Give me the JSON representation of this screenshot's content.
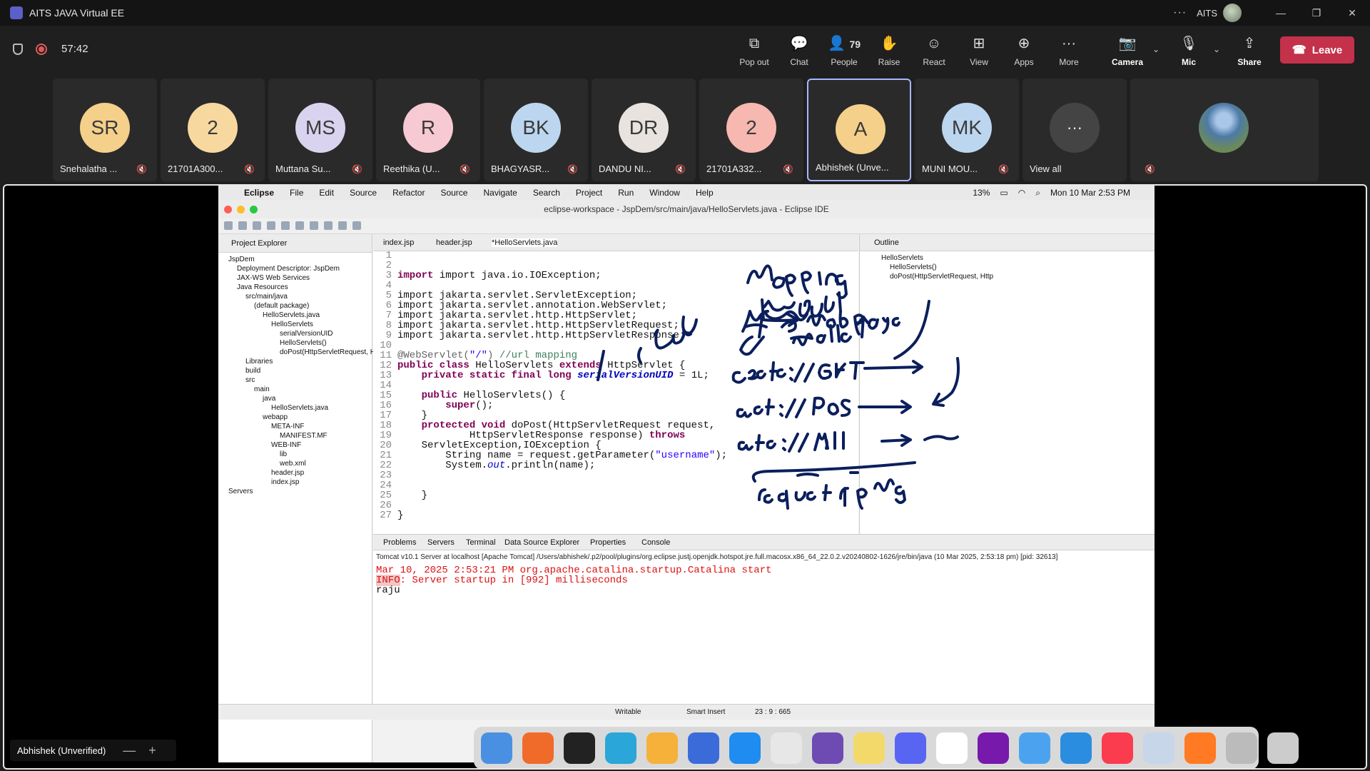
{
  "window": {
    "title": "AITS JAVA Virtual EE",
    "org": "AITS"
  },
  "meeting": {
    "timer": "57:42",
    "controls": {
      "popout": "Pop out",
      "chat": "Chat",
      "people": "People",
      "people_count": "79",
      "raise": "Raise",
      "react": "React",
      "view": "View",
      "apps": "Apps",
      "more": "More",
      "camera": "Camera",
      "mic": "Mic",
      "share": "Share",
      "leave": "Leave"
    },
    "participants": [
      {
        "initials": "SR",
        "name": "Snehalatha ...",
        "color": "#f5d08a"
      },
      {
        "initials": "2",
        "name": "21701A300...",
        "color": "#f7d9a0"
      },
      {
        "initials": "MS",
        "name": "Muttana Su...",
        "color": "#d9d3ef"
      },
      {
        "initials": "R",
        "name": "Reethika (U...",
        "color": "#f7c9d2"
      },
      {
        "initials": "BK",
        "name": "BHAGYASR...",
        "color": "#bcd6f0"
      },
      {
        "initials": "DR",
        "name": "DANDU NI...",
        "color": "#e8e3df"
      },
      {
        "initials": "2",
        "name": "21701A332...",
        "color": "#f6b8b0"
      },
      {
        "initials": "A",
        "name": "Abhishek (Unve...",
        "color": "#f5d08a"
      },
      {
        "initials": "MK",
        "name": "MUNI MOU...",
        "color": "#bcd6f0"
      }
    ],
    "view_all": "View all",
    "presenter_name": "Abhishek (Unverified)"
  },
  "mac_menu": {
    "app": "Eclipse",
    "items": [
      "File",
      "Edit",
      "Source",
      "Refactor",
      "Source",
      "Navigate",
      "Search",
      "Project",
      "Run",
      "Window",
      "Help"
    ],
    "battery": "13%",
    "clock": "Mon 10 Mar  2:53 PM"
  },
  "eclipse": {
    "title": "eclipse-workspace - JspDem/src/main/java/HelloServlets.java - Eclipse IDE",
    "project_explorer": {
      "title": "Project Explorer",
      "tree": [
        "JspDem",
        "Deployment Descriptor: JspDem",
        "JAX-WS Web Services",
        "Java Resources",
        "src/main/java",
        "(default package)",
        "HelloServlets.java",
        "HelloServlets",
        "serialVersionUID",
        "HelloServlets()",
        "doPost(HttpServletRequest, Htt",
        "Libraries",
        "build",
        "src",
        "main",
        "java",
        "HelloServlets.java",
        "webapp",
        "META-INF",
        "MANIFEST.MF",
        "WEB-INF",
        "lib",
        "web.xml",
        "header.jsp",
        "index.jsp",
        "Servers"
      ]
    },
    "editor_tabs": [
      "index.jsp",
      "header.jsp",
      "*HelloServlets.java"
    ],
    "outline": {
      "title": "Outline",
      "items": [
        "HelloServlets",
        "HelloServlets()",
        "doPost(HttpServletRequest, Http"
      ]
    },
    "code_lines": [
      "1",
      "2",
      "3",
      "4",
      "5",
      "6",
      "7",
      "8",
      "9",
      "10",
      "11",
      "12",
      "13",
      "14",
      "15",
      "16",
      "17",
      "18",
      "19",
      "20",
      "21",
      "22",
      "23",
      "24",
      "25",
      "26",
      "27"
    ],
    "code": {
      "l3": "import java.io.IOException;",
      "l5": "import jakarta.servlet.ServletException;",
      "l6": "import jakarta.servlet.annotation.WebServlet;",
      "l7": "import jakarta.servlet.http.HttpServlet;",
      "l8": "import jakarta.servlet.http.HttpServletRequest;",
      "l9": "import jakarta.servlet.http.HttpServletResponse;",
      "l11_ann": "@WebServlet(",
      "l11_str": "\"/\"",
      "l11_close": ")",
      "l11_cm": "//url mapping",
      "l12_kw1": "public class",
      "l12_name": "HelloServlets",
      "l12_kw2": "extends",
      "l12_rest": "HttpServlet {",
      "l13_kw": "private static final long",
      "l13_field": "serialVersionUID",
      "l13_rest": "= 1L;",
      "l15_kw": "public",
      "l15_rest": "HelloServlets() {",
      "l16_kw": "super",
      "l16_rest": "();",
      "l17": "}",
      "l18_kw": "protected void",
      "l18_rest": "doPost(HttpServletRequest request,",
      "l19_rest": "HttpServletResponse response)",
      "l19_kw": "throws",
      "l20": "ServletException,IOException {",
      "l21_a": "String name = request.getParameter(",
      "l21_str": "\"username\"",
      "l21_b": ");",
      "l22_a": "System.",
      "l22_out": "out",
      "l22_b": ".println(name);",
      "l24": "}",
      "l26": "}"
    },
    "bottom_tabs": [
      "Problems",
      "Servers",
      "Terminal",
      "Data Source Explorer",
      "Properties",
      "Console"
    ],
    "console": {
      "path": "Tomcat v10.1 Server at localhost [Apache Tomcat] /Users/abhishek/.p2/pool/plugins/org.eclipse.justj.openjdk.hotspot.jre.full.macosx.x86_64_22.0.2.v20240802-1626/jre/bin/java  (10 Mar 2025, 2:53:18 pm) [pid: 32613]",
      "line1": "Mar 10, 2025 2:53:21 PM org.apache.catalina.startup.Catalina start",
      "line2_tag": "INFO",
      "line2_rest": ": Server startup in [992] milliseconds",
      "line3": "raju"
    },
    "status": {
      "writable": "Writable",
      "insert": "Smart Insert",
      "position": "23 : 9 : 665"
    }
  }
}
